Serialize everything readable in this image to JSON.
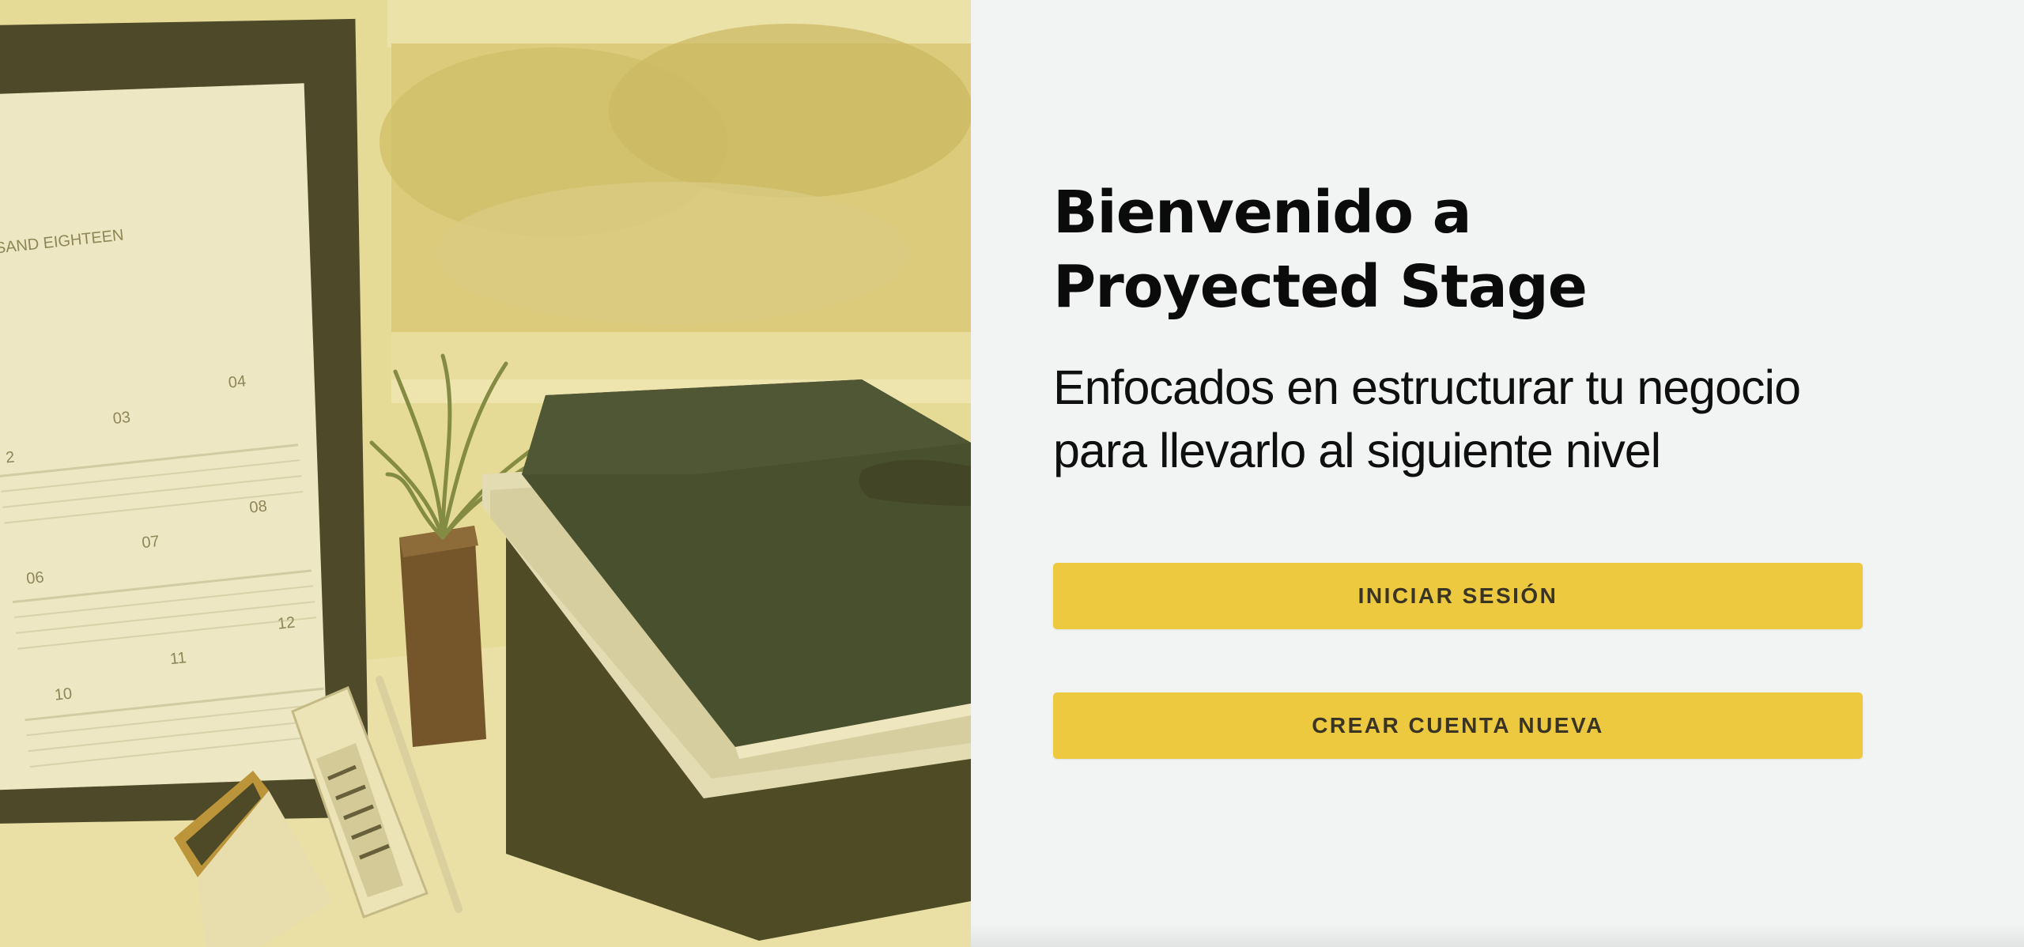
{
  "hero": {
    "image_alt": "Escritorio con calendario, agenda de cuero y planta",
    "overlay_color": "#e9d96a",
    "calendar_header": "USAND EIGHTEEN",
    "calendar_months": [
      "2",
      "03",
      "04",
      "06",
      "07",
      "08",
      "10",
      "11",
      "12"
    ]
  },
  "welcome": {
    "title_line1": "Bienvenido a",
    "title_line2": "Proyected Stage",
    "subtitle_line1": "Enfocados en estructurar tu negocio",
    "subtitle_line2": "para llevarlo al siguiente nivel"
  },
  "actions": {
    "login_label": "INICIAR SESIÓN",
    "register_label": "CREAR CUENTA NUEVA"
  },
  "colors": {
    "accent": "#ecc93e",
    "background": "#f2f4f3",
    "text": "#0b0b0b"
  }
}
